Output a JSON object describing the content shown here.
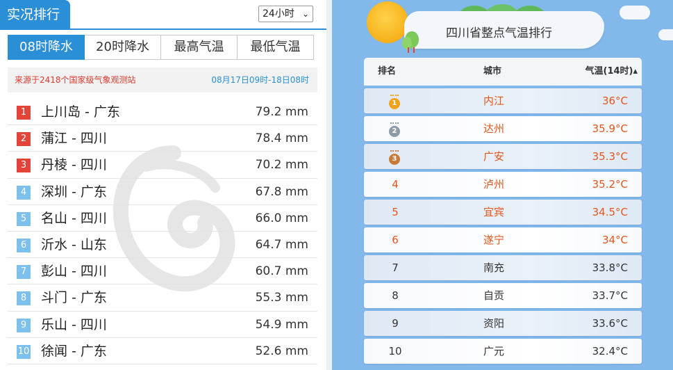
{
  "left": {
    "title": "实况排行",
    "time_select": "24小时",
    "tabs": [
      "08时降水",
      "20时降水",
      "最高气温",
      "最低气温"
    ],
    "active_tab": 0,
    "source_text": "来源于2418个国家级气象观测站",
    "date_range": "08月17日09时-18日08时",
    "rankings": [
      {
        "rank": "1",
        "name": "上川岛 - 广东",
        "value": "79.2 mm",
        "color": "#e2443a"
      },
      {
        "rank": "2",
        "name": "蒲江 - 四川",
        "value": "78.4 mm",
        "color": "#e2443a"
      },
      {
        "rank": "3",
        "name": "丹棱 - 四川",
        "value": "70.2 mm",
        "color": "#e2443a"
      },
      {
        "rank": "4",
        "name": "深圳 - 广东",
        "value": "67.8 mm",
        "color": "#7ec0ec"
      },
      {
        "rank": "5",
        "name": "名山 - 四川",
        "value": "66.0 mm",
        "color": "#7ec0ec"
      },
      {
        "rank": "6",
        "name": "沂水 - 山东",
        "value": "64.7 mm",
        "color": "#7ec0ec"
      },
      {
        "rank": "7",
        "name": "彭山 - 四川",
        "value": "60.7 mm",
        "color": "#7ec0ec"
      },
      {
        "rank": "8",
        "name": "斗门 - 广东",
        "value": "55.3 mm",
        "color": "#7ec0ec"
      },
      {
        "rank": "9",
        "name": "乐山 - 四川",
        "value": "54.9 mm",
        "color": "#7ec0ec"
      },
      {
        "rank": "10",
        "name": "徐闻 - 广东",
        "value": "52.6 mm",
        "color": "#7ec0ec"
      }
    ]
  },
  "right": {
    "title": "四川省整点气温排行",
    "columns": {
      "rank": "排名",
      "city": "城市",
      "temp": "气温(14时)▴"
    },
    "rows": [
      {
        "rank": "1",
        "city": "内江",
        "temp": "36°C",
        "medal": "gold"
      },
      {
        "rank": "2",
        "city": "达州",
        "temp": "35.9°C",
        "medal": "silver"
      },
      {
        "rank": "3",
        "city": "广安",
        "temp": "35.3°C",
        "medal": "bronze"
      },
      {
        "rank": "4",
        "city": "泸州",
        "temp": "35.2°C",
        "medal": ""
      },
      {
        "rank": "5",
        "city": "宜宾",
        "temp": "34.5°C",
        "medal": ""
      },
      {
        "rank": "6",
        "city": "遂宁",
        "temp": "34°C",
        "medal": ""
      },
      {
        "rank": "7",
        "city": "南充",
        "temp": "33.8°C",
        "medal": ""
      },
      {
        "rank": "8",
        "city": "自贡",
        "temp": "33.7°C",
        "medal": ""
      },
      {
        "rank": "9",
        "city": "资阳",
        "temp": "33.6°C",
        "medal": ""
      },
      {
        "rank": "10",
        "city": "广元",
        "temp": "32.4°C",
        "medal": ""
      }
    ],
    "hot_color": "#e3561d",
    "medal_colors": {
      "gold": "#f0a21a",
      "silver": "#8e9aa6",
      "bronze": "#c97b3a"
    }
  }
}
